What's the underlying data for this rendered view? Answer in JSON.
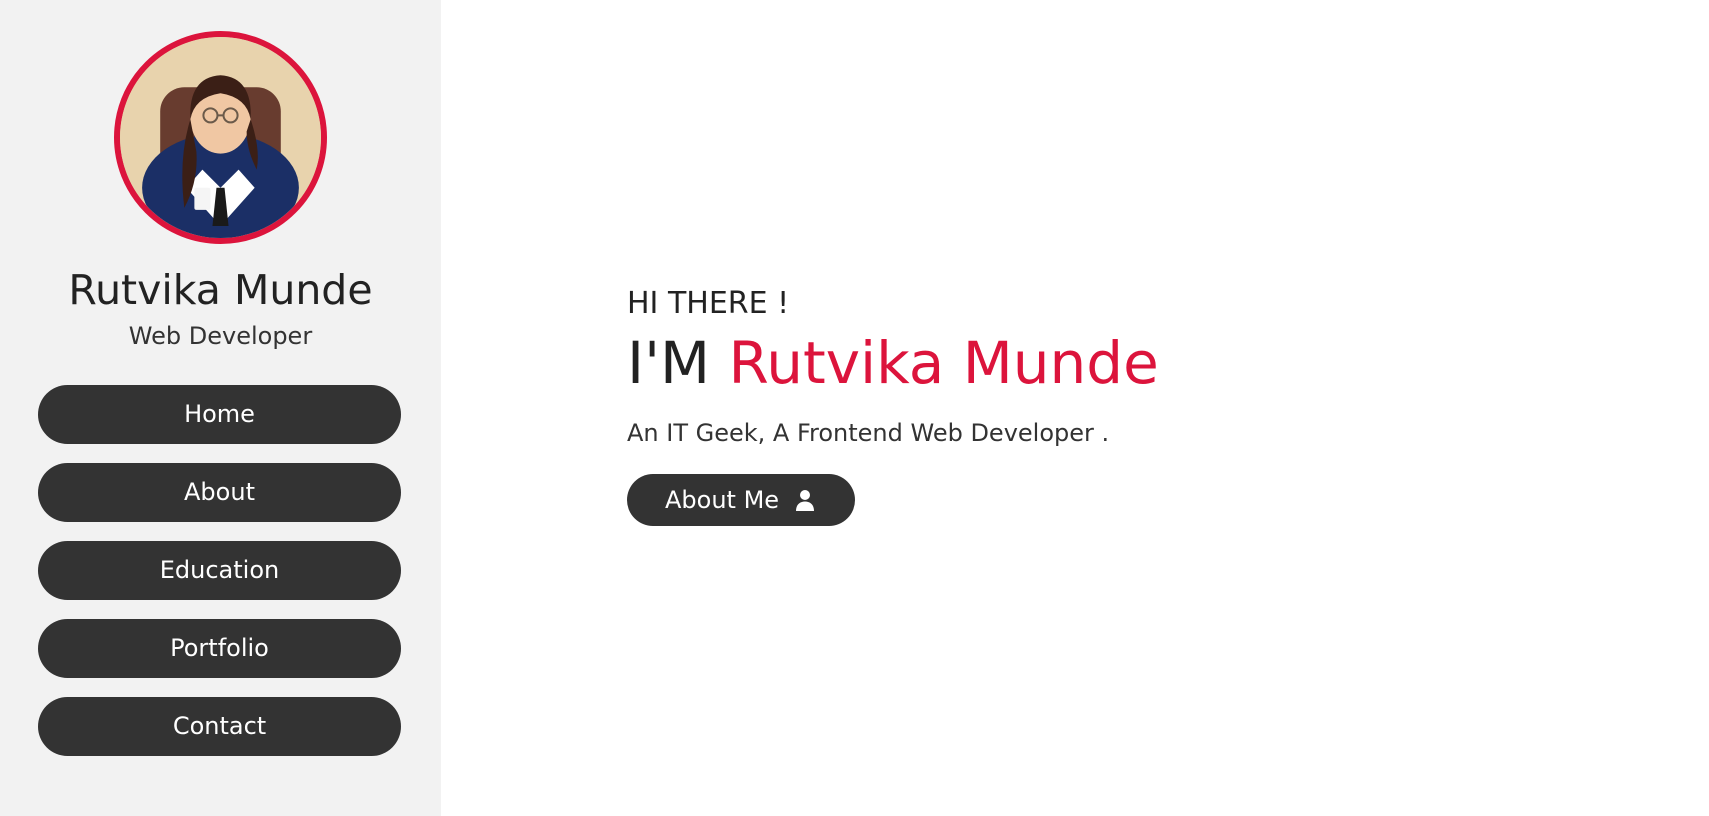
{
  "sidebar": {
    "name": "Rutvika Munde",
    "role": "Web Developer",
    "nav": [
      {
        "label": "Home"
      },
      {
        "label": "About"
      },
      {
        "label": "Education"
      },
      {
        "label": "Portfolio"
      },
      {
        "label": "Contact"
      }
    ]
  },
  "hero": {
    "greeting": "HI THERE !",
    "headline_prefix": "I'M",
    "headline_name": "Rutvika Munde",
    "tagline": "An IT Geek, A Frontend Web Developer .",
    "button_label": "About Me",
    "button_icon": "user-icon"
  },
  "colors": {
    "accent": "#dc143c",
    "sidebar_bg": "#f2f2f2",
    "button_bg": "#333333",
    "text": "#222222"
  }
}
